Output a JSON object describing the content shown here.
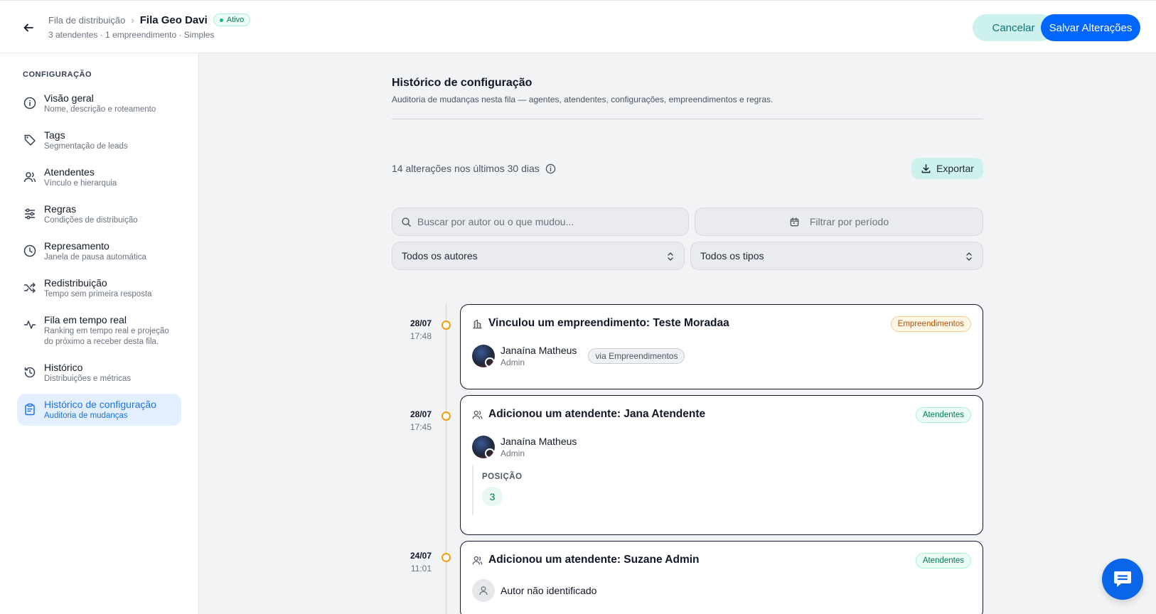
{
  "header": {
    "breadcrumb_parent": "Fila de distribuição",
    "breadcrumb_separator": "›",
    "title": "Fila Geo Davi",
    "status": "Ativo",
    "meta": "3 atendentes · 1 empreendimento · Simples",
    "cancel_label": "Cancelar",
    "save_label": "Salvar Alterações"
  },
  "sidebar": {
    "section_title": "CONFIGURAÇÃO",
    "items": [
      {
        "label": "Visão geral",
        "desc": "Nome, descrição e roteamento",
        "icon": "info-icon"
      },
      {
        "label": "Tags",
        "desc": "Segmentação de leads",
        "icon": "tag-icon"
      },
      {
        "label": "Atendentes",
        "desc": "Vínculo e hierarquia",
        "icon": "users-icon"
      },
      {
        "label": "Regras",
        "desc": "Condições de distribuição",
        "icon": "sliders-icon"
      },
      {
        "label": "Represamento",
        "desc": "Janela de pausa automática",
        "icon": "clock-icon"
      },
      {
        "label": "Redistribuição",
        "desc": "Tempo sem primeira resposta",
        "icon": "shuffle-icon"
      },
      {
        "label": "Fila em tempo real",
        "desc": "Ranking em tempo real e projeção do próximo a receber desta fila.",
        "icon": "activity-icon"
      },
      {
        "label": "Histórico",
        "desc": "Distribuições e métricas",
        "icon": "history-icon"
      },
      {
        "label": "Histórico de configuração",
        "desc": "Auditoria de mudanças",
        "icon": "clipboard-icon",
        "active": true
      }
    ]
  },
  "main": {
    "title": "Histórico de configuração",
    "subtitle": "Auditoria de mudanças nesta fila — agentes, atendentes, configurações, empreendimentos e regras.",
    "stats": "14 alterações nos últimos 30 dias",
    "export_label": "Exportar",
    "search_placeholder": "Buscar por autor ou o que mudou...",
    "period_placeholder": "Filtrar por período",
    "authors_select": "Todos os autores",
    "types_select": "Todos os tipos"
  },
  "timeline": [
    {
      "date": "28/07",
      "time": "17:48",
      "title": "Vinculou um empreendimento: Teste Moradaa",
      "tag": "Empreendimentos",
      "author": "Janaína Matheus",
      "role": "Admin",
      "via": "via Empreendimentos"
    },
    {
      "date": "28/07",
      "time": "17:45",
      "title": "Adicionou um atendente: Jana Atendente",
      "tag": "Atendentes",
      "author": "Janaína Matheus",
      "role": "Admin",
      "detail_label": "POSIÇÃO",
      "detail_value": "3"
    },
    {
      "date": "24/07",
      "time": "11:01",
      "title": "Adicionou um atendente: Suzane Admin",
      "tag": "Atendentes",
      "author": "Autor não identificado"
    }
  ],
  "colors": {
    "primary": "#0066ff",
    "mint": "#cdf1ec",
    "active_nav_bg": "#e3efff",
    "timeline_dot": "#f59e0b"
  }
}
